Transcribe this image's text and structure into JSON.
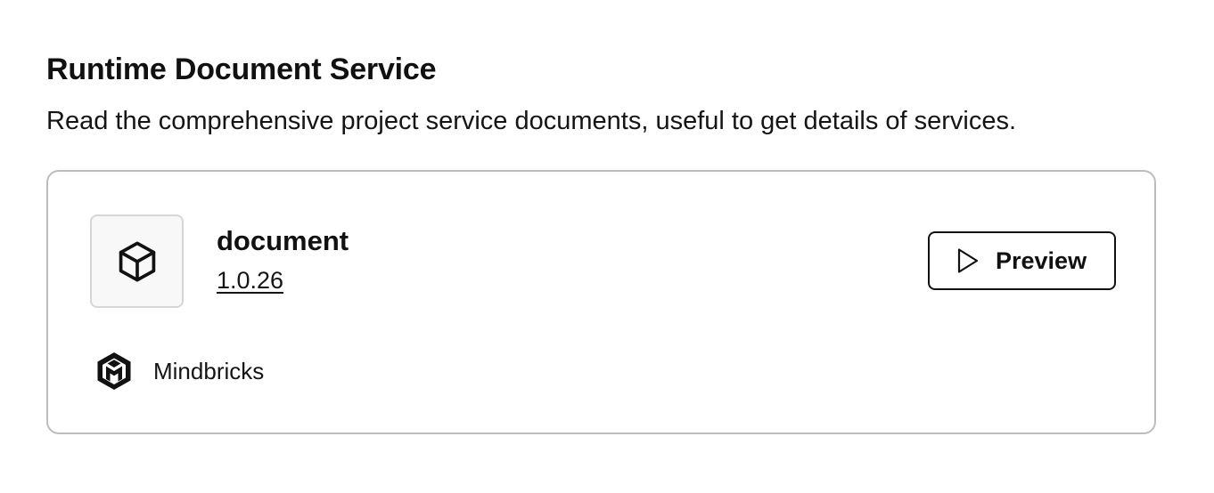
{
  "section": {
    "title": "Runtime Document Service",
    "description": "Read the comprehensive project service documents, useful to get details of services."
  },
  "card": {
    "icon": "package-cube-icon",
    "name": "document",
    "version": "1.0.26",
    "preview_label": "Preview",
    "preview_icon": "play-icon",
    "author": {
      "name": "Mindbricks",
      "logo_icon": "mindbricks-logo-icon"
    }
  },
  "colors": {
    "text": "#111111",
    "card_border": "#bdbdbd",
    "tile_background": "#f8f8f8",
    "tile_border": "#d6d6d6",
    "button_border": "#111111"
  }
}
